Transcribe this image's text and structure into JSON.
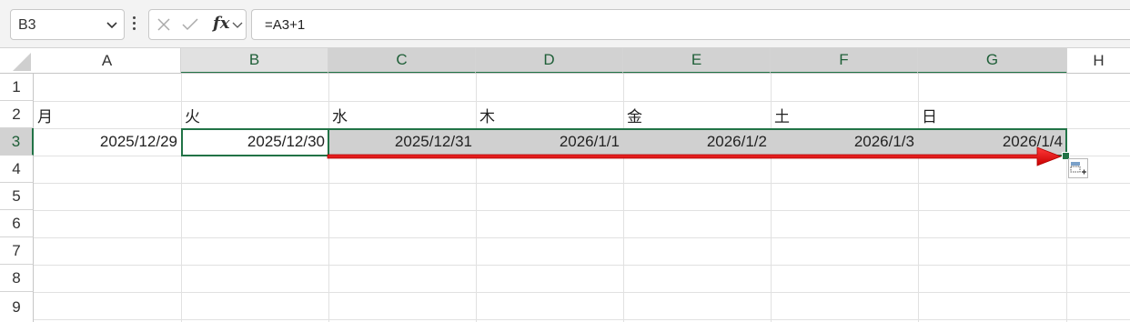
{
  "formula_bar": {
    "name_box": "B3",
    "formula": "=A3+1",
    "fx_label": "fx"
  },
  "columns": [
    "A",
    "B",
    "C",
    "D",
    "E",
    "F",
    "G",
    "H"
  ],
  "rows": [
    "1",
    "2",
    "3",
    "4",
    "5",
    "6",
    "7",
    "8",
    "9"
  ],
  "cells": {
    "A2": "月",
    "B2": "火",
    "C2": "水",
    "D2": "木",
    "E2": "金",
    "F2": "土",
    "G2": "日",
    "A3": "2025/12/29",
    "B3": "2025/12/30",
    "C3": "2025/12/31",
    "D3": "2026/1/1",
    "E3": "2026/1/2",
    "F3": "2026/1/3",
    "G3": "2026/1/4"
  },
  "colors": {
    "selection": "#217346",
    "fill_range": "#d0d0d0",
    "arrow": "#e00000"
  },
  "icons": [
    "chevron-down-icon",
    "more-options-icon",
    "cancel-icon",
    "enter-icon",
    "insert-function-icon",
    "auto-fill-options-icon"
  ]
}
